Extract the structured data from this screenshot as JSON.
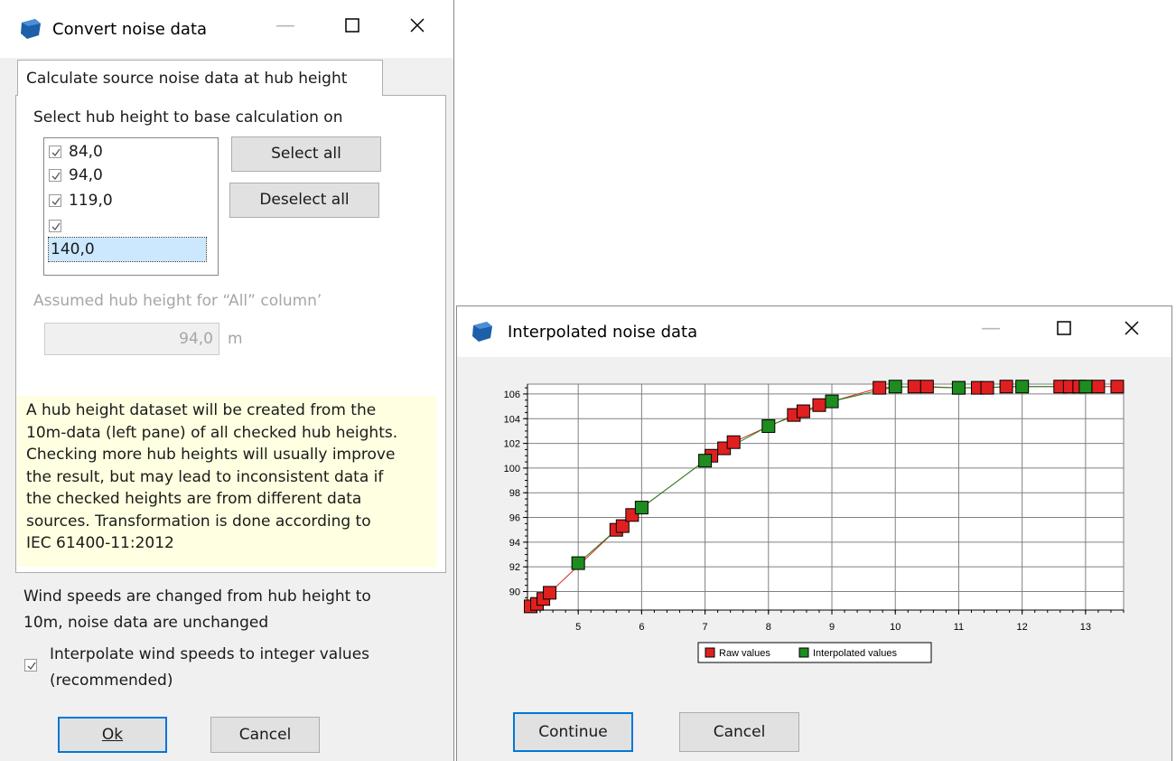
{
  "convert_dialog": {
    "title": "Convert noise data",
    "tab_label": "Calculate source noise data at hub height",
    "select_label": "Select hub height to base calculation on",
    "hub_heights": [
      {
        "label": "84,0",
        "checked": true
      },
      {
        "label": "94,0",
        "checked": true
      },
      {
        "label": "119,0",
        "checked": true
      },
      {
        "label": "140,0",
        "checked": true
      }
    ],
    "select_all_label": "Select all",
    "deselect_all_label": "Deselect all",
    "assumed_label": "Assumed hub height for “All” column’",
    "assumed_value": "94,0",
    "assumed_unit": "m",
    "info_text": "A hub height dataset will be created from the\n10m-data (left pane) of all checked hub heights.\nChecking more hub heights will usually improve\nthe result, but may lead to inconsistent data if\nthe checked heights are from different data\nsources. Transformation is done according to\nIEC 61400-11:2012",
    "wind_note": "Wind speeds are changed from hub height to\n10m, noise data are unchanged",
    "interpolate_label": "Interpolate wind speeds to integer values\n(recommended)",
    "interpolate_checked": true,
    "ok_label": "Ok",
    "cancel_label": "Cancel"
  },
  "interp_dialog": {
    "title": "Interpolated noise data",
    "continue_label": "Continue",
    "cancel_label": "Cancel"
  },
  "colors": {
    "raw": "#e02020",
    "interpolated": "#1e8c1e",
    "accent": "#0078d7",
    "app_icon": "#1d5fa8"
  },
  "chart_data": {
    "type": "line",
    "x_ticks": [
      "5",
      "6",
      "7",
      "8",
      "9",
      "10",
      "11",
      "12",
      "13"
    ],
    "y_ticks": [
      "90",
      "92",
      "94",
      "96",
      "98",
      "100",
      "102",
      "104",
      "106"
    ],
    "xlim": [
      4.2,
      13.6
    ],
    "ylim": [
      88.5,
      106.8
    ],
    "grid": true,
    "legend_position": "bottom",
    "series": [
      {
        "name": "Raw values",
        "x": [
          4.25,
          4.35,
          4.45,
          4.55,
          5.6,
          5.7,
          5.85,
          7.1,
          7.3,
          7.45,
          8.4,
          8.55,
          8.8,
          9.75,
          10.3,
          10.5,
          11,
          11.3,
          11.45,
          11.75,
          12.6,
          12.75,
          12.9,
          13.2,
          13.5
        ],
        "y": [
          88.8,
          89.0,
          89.4,
          89.9,
          95.0,
          95.3,
          96.2,
          101.0,
          101.6,
          102.1,
          104.3,
          104.6,
          105.1,
          106.5,
          106.6,
          106.6,
          106.5,
          106.5,
          106.5,
          106.6,
          106.6,
          106.6,
          106.6,
          106.6,
          106.6
        ]
      },
      {
        "name": "Interpolated values",
        "x": [
          5,
          6,
          7,
          8,
          9,
          10,
          11,
          12,
          13
        ],
        "y": [
          92.3,
          96.8,
          100.6,
          103.4,
          105.4,
          106.6,
          106.5,
          106.6,
          106.6
        ]
      }
    ]
  }
}
